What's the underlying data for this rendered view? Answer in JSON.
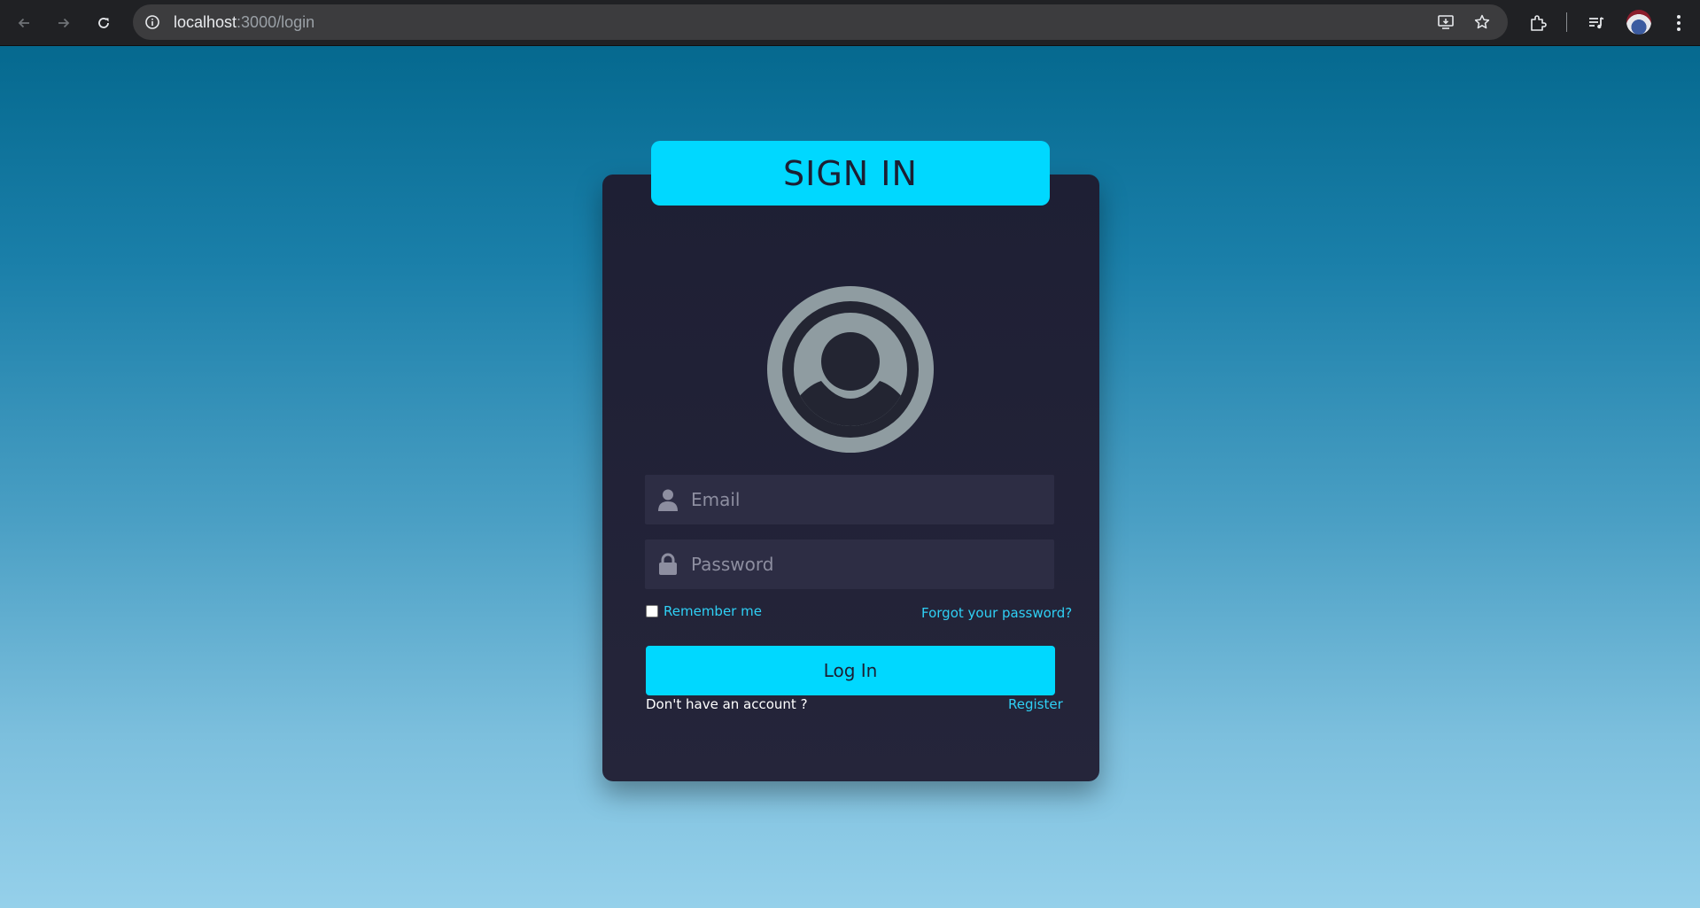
{
  "browser": {
    "url_host": "localhost",
    "url_path": ":3000/login",
    "icons": {
      "back": "arrow-left-icon",
      "forward": "arrow-right-icon",
      "reload": "reload-icon",
      "site_info": "info-icon",
      "install": "install-app-icon",
      "bookmark": "star-icon",
      "extensions": "puzzle-icon",
      "media": "media-control-icon",
      "profile": "profile-avatar",
      "menu": "kebab-menu-icon"
    }
  },
  "login": {
    "title": "SIGN IN",
    "email_placeholder": "Email",
    "password_placeholder": "Password",
    "remember_label": "Remember me",
    "remember_checked": false,
    "forgot_label": "Forgot your password?",
    "submit_label": "Log In",
    "no_account_text": "Don't have an account ?",
    "register_label": "Register"
  },
  "colors": {
    "accent": "#00d8ff",
    "card": "#1e1f34",
    "field": "#2d2d44",
    "link": "#2fd0f5",
    "bg_top": "#05698f",
    "bg_bottom": "#95d0ea"
  }
}
